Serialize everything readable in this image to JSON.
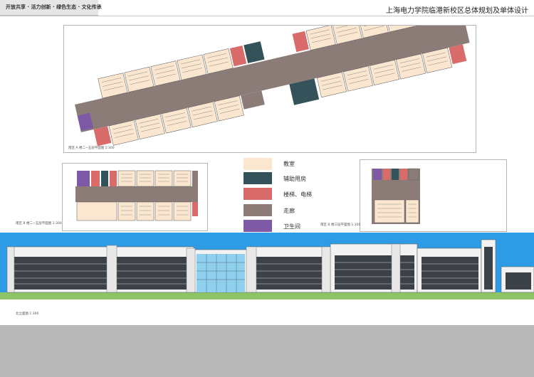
{
  "header": {
    "slogan": "开放共享 · 活力创新 · 绿色生态 · 文化传承",
    "title": "上海电力学院临港新校区总体规划及单体设计"
  },
  "captions": {
    "plan_main": "南区 A 楼二~五层平面图  1:300",
    "plan_left": "南区 B 楼二~五层平面图  1:300",
    "plan_right": "南区 B 楼三层平面图  1:300",
    "elevation": "北立面图  1:300"
  },
  "legend": [
    {
      "label": "教室",
      "color": "#fbe7d0"
    },
    {
      "label": "辅助用房",
      "color": "#33525a"
    },
    {
      "label": "楼梯、电梯",
      "color": "#d96b6b"
    },
    {
      "label": "走廊",
      "color": "#8c7c78"
    },
    {
      "label": "卫生间",
      "color": "#7e5aa5"
    }
  ],
  "colors": {
    "classroom": "#fbe7d0",
    "auxiliary": "#33525a",
    "stair": "#d96b6b",
    "corridor": "#8c7c78",
    "toilet": "#7e5aa5",
    "sky": "#2e9be6",
    "glass": "#8fd0ee",
    "ground": "#8cc466"
  }
}
